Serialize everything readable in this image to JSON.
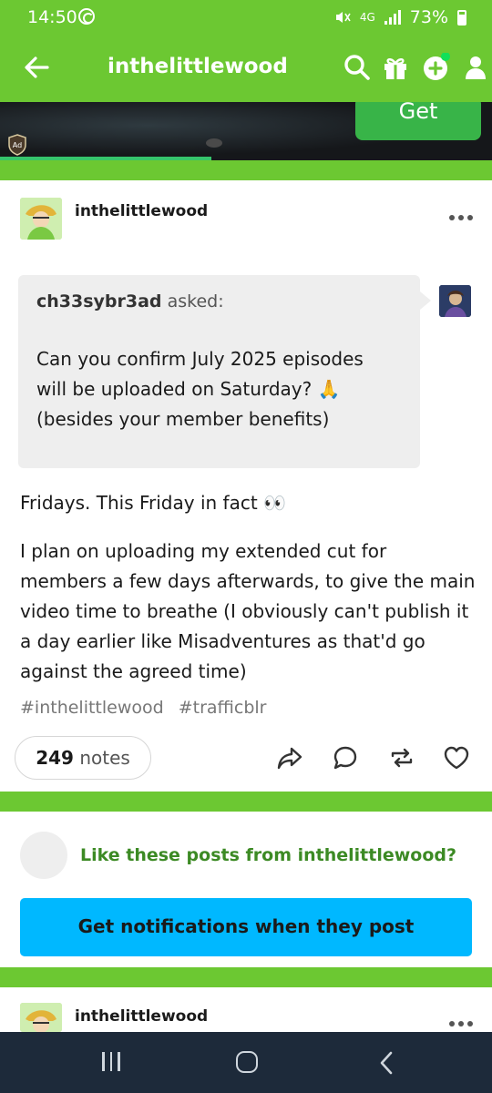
{
  "status_bar": {
    "time": "14:50",
    "network": "4G",
    "battery": "73%"
  },
  "header": {
    "title": "inthelittlewood",
    "icons": [
      "back-arrow-icon",
      "search-icon",
      "gift-icon",
      "compose-icon",
      "account-icon"
    ]
  },
  "ad": {
    "cta_label": "Get",
    "badge": "Ad"
  },
  "post": {
    "blog_name": "inthelittlewood",
    "ask": {
      "asker": "ch33sybr3ad",
      "asked_label": "asked:",
      "question_lines": [
        "Can you confirm July 2025 episodes",
        "will be uploaded on Saturday? 🙏",
        "(besides your member benefits)"
      ]
    },
    "answer_paragraphs": [
      "Fridays. This Friday in fact 👀",
      "I plan on uploading my extended cut for members a few days afterwards, to give the main video time to breathe (I obviously can't publish it a day earlier like Misadventures as that'd go against the agreed time)"
    ],
    "tags": [
      "#inthelittlewood",
      "#trafficblr"
    ],
    "notes_count": "249",
    "notes_label": "notes",
    "actions": [
      "share-icon",
      "reply-icon",
      "reblog-icon",
      "like-icon"
    ]
  },
  "follow_prompt": {
    "text": "Like these posts from inthelittlewood?",
    "button_label": "Get notifications when they post"
  },
  "next_post": {
    "blog_name": "inthelittlewood"
  },
  "colors": {
    "brand_green": "#6cc832",
    "button_blue": "#00b8ff",
    "link_green": "#3c8a24"
  }
}
